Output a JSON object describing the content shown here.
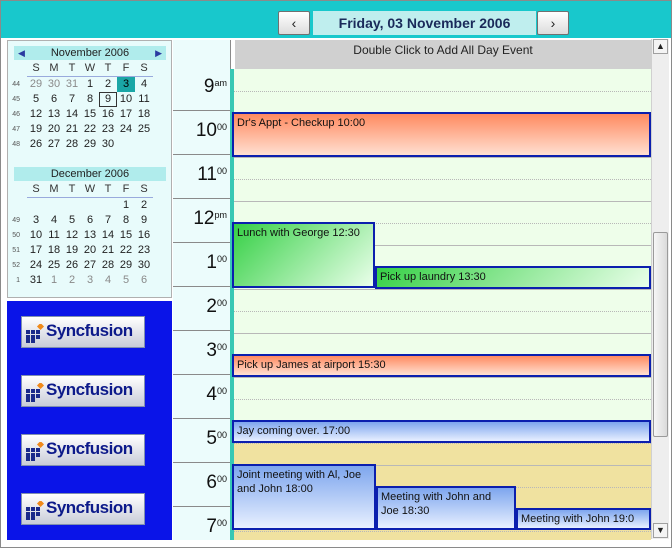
{
  "header": {
    "date_title": "Friday, 03 November 2006",
    "prev_label": "‹",
    "next_label": "›"
  },
  "calendars": [
    {
      "title": "November 2006",
      "dow": [
        "S",
        "M",
        "T",
        "W",
        "T",
        "F",
        "S"
      ],
      "weeks": [
        {
          "wk": "44",
          "days": [
            "29",
            "30",
            "31",
            "1",
            "2",
            "3",
            "4"
          ]
        },
        {
          "wk": "45",
          "days": [
            "5",
            "6",
            "7",
            "8",
            "9",
            "10",
            "11"
          ]
        },
        {
          "wk": "46",
          "days": [
            "12",
            "13",
            "14",
            "15",
            "16",
            "17",
            "18"
          ]
        },
        {
          "wk": "47",
          "days": [
            "19",
            "20",
            "21",
            "22",
            "23",
            "24",
            "25"
          ]
        },
        {
          "wk": "48",
          "days": [
            "26",
            "27",
            "28",
            "29",
            "30",
            "",
            ""
          ]
        }
      ]
    },
    {
      "title": "December 2006",
      "dow": [
        "S",
        "M",
        "T",
        "W",
        "T",
        "F",
        "S"
      ],
      "weeks": [
        {
          "wk": "",
          "days": [
            "",
            "",
            "",
            "",
            "",
            "1",
            "2"
          ]
        },
        {
          "wk": "49",
          "days": [
            "3",
            "4",
            "5",
            "6",
            "7",
            "8",
            "9"
          ]
        },
        {
          "wk": "50",
          "days": [
            "10",
            "11",
            "12",
            "13",
            "14",
            "15",
            "16"
          ]
        },
        {
          "wk": "51",
          "days": [
            "17",
            "18",
            "19",
            "20",
            "21",
            "22",
            "23"
          ]
        },
        {
          "wk": "52",
          "days": [
            "24",
            "25",
            "26",
            "27",
            "28",
            "29",
            "30"
          ]
        },
        {
          "wk": "1",
          "days": [
            "31",
            "1",
            "2",
            "3",
            "4",
            "5",
            "6"
          ]
        }
      ]
    }
  ],
  "logo_text": "Syncfusion",
  "allday_hint": "Double Click to Add All Day Event",
  "hours": [
    {
      "n": "9",
      "s": "am"
    },
    {
      "n": "10",
      "s": "00"
    },
    {
      "n": "11",
      "s": "00"
    },
    {
      "n": "12",
      "s": "pm"
    },
    {
      "n": "1",
      "s": "00"
    },
    {
      "n": "2",
      "s": "00"
    },
    {
      "n": "3",
      "s": "00"
    },
    {
      "n": "4",
      "s": "00"
    },
    {
      "n": "5",
      "s": "00"
    },
    {
      "n": "6",
      "s": "00"
    },
    {
      "n": "7",
      "s": "00"
    }
  ],
  "appointments": [
    {
      "text": "Dr's Appt - Checkup 10:00"
    },
    {
      "text": "Lunch with George 12:30"
    },
    {
      "text": "Pick up laundry 13:30"
    },
    {
      "text": "Pick up James at airport 15:30"
    },
    {
      "text": "Jay coming over. 17:00"
    },
    {
      "text": "Joint meeting with Al, Joe and John 18:00"
    },
    {
      "text": "Meeting with John and Joe 18:30"
    },
    {
      "text": "Meeting with John 19:0"
    }
  ],
  "colors": {
    "accent": "#18c8cc",
    "appt_border": "#0b1fae",
    "logo_panel": "#0a14e8",
    "after_hours": "#f0e2a0",
    "work_hours": "#eefeea"
  }
}
